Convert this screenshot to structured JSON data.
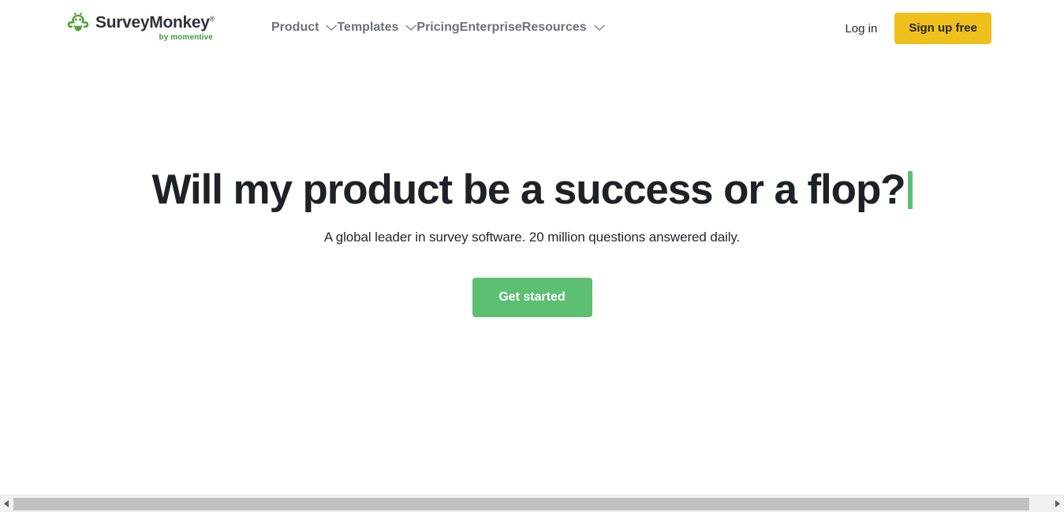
{
  "header": {
    "logo": {
      "name": "SurveyMonkey",
      "registered_mark": "®",
      "tagline": "by momentive",
      "icon": "surveymonkey-monkey-icon",
      "brand_green": "#3f9b35",
      "wordmark_color": "#2f3337"
    },
    "nav": [
      {
        "label": "Product",
        "has_dropdown": true,
        "icon": "chevron-down-icon"
      },
      {
        "label": "Templates",
        "has_dropdown": true,
        "icon": "chevron-down-icon"
      },
      {
        "label": "Pricing",
        "has_dropdown": false
      },
      {
        "label": "Enterprise",
        "has_dropdown": false
      },
      {
        "label": "Resources",
        "has_dropdown": true,
        "icon": "chevron-down-icon"
      }
    ],
    "nav_color": "#69727d",
    "auth": {
      "login_label": "Log in",
      "signup_label": "Sign up free",
      "signup_bg": "#efc01c",
      "signup_text_color": "#23282d"
    }
  },
  "hero": {
    "headline": "Will my product be a success or a flop?",
    "cursor_color": "#5cbf72",
    "subheadline": "A global leader in survey software. 20 million questions answered daily.",
    "cta_label": "Get started",
    "cta_bg": "#5cbf72",
    "cta_text_color": "#ffffff",
    "headline_color": "#1e2226"
  },
  "scrollbar": {
    "orientation": "horizontal",
    "left_arrow_icon": "triangle-left-icon",
    "right_arrow_icon": "triangle-right-icon",
    "thumb_color": "#c1c1c1",
    "track_color": "#f1f1f1"
  }
}
